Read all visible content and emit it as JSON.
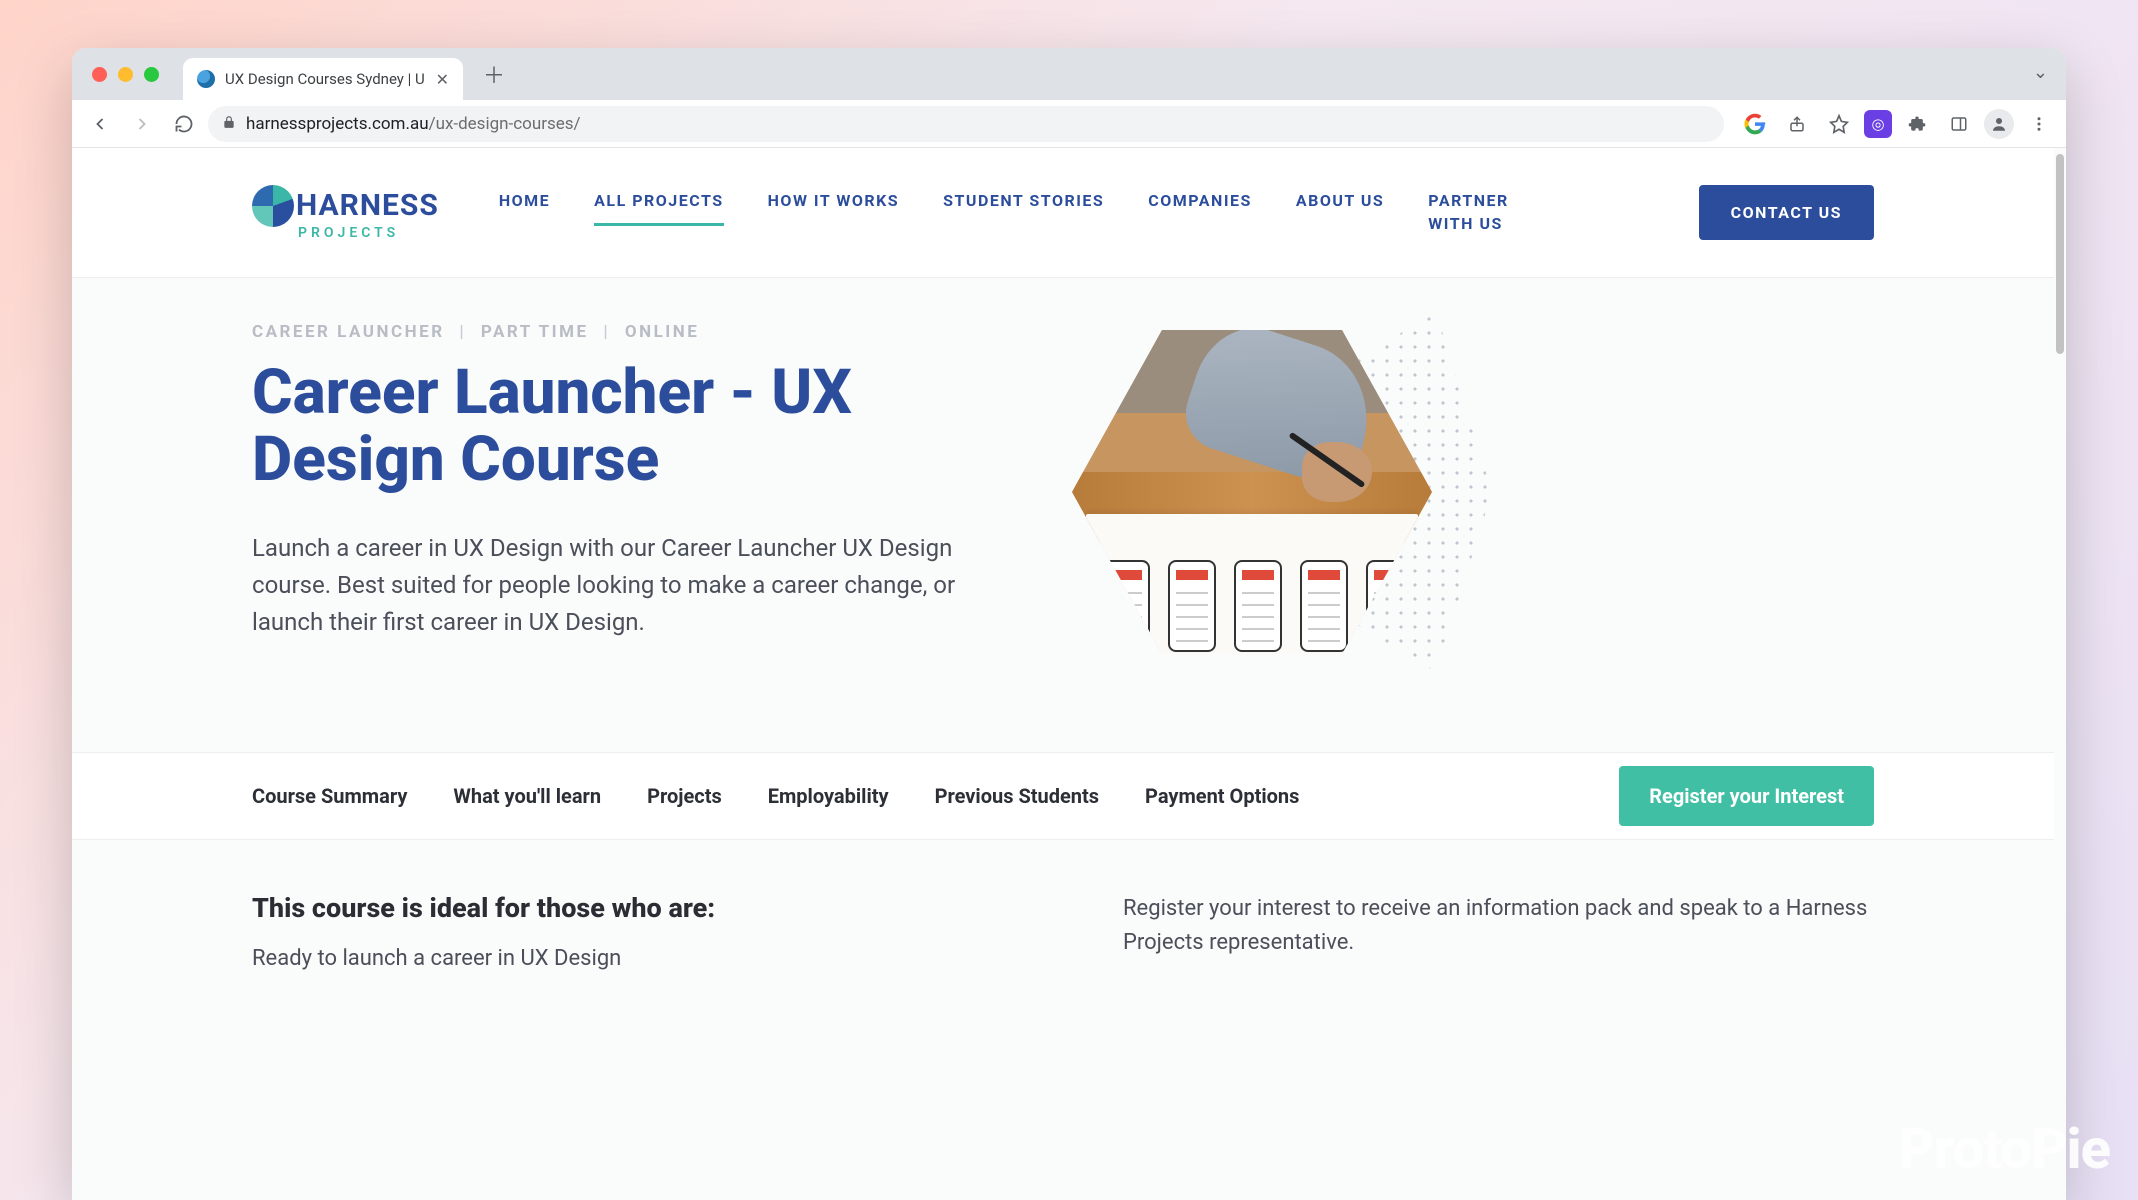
{
  "browser": {
    "tab_title": "UX Design Courses Sydney | U",
    "url_domain": "harnessprojects.com.au",
    "url_path": "/ux-design-courses/"
  },
  "logo": {
    "main": "HARNESS",
    "sub": "PROJECTS"
  },
  "nav": {
    "items": [
      "HOME",
      "ALL PROJECTS",
      "HOW IT WORKS",
      "STUDENT STORIES",
      "COMPANIES",
      "ABOUT US",
      "PARTNER WITH US"
    ],
    "contact": "CONTACT US"
  },
  "hero": {
    "crumbs": [
      "CAREER LAUNCHER",
      "PART TIME",
      "ONLINE"
    ],
    "title": "Career Launcher - UX Design Course",
    "desc": "Launch a career in UX Design with our Career Launcher UX Design course. Best suited for people looking to make a career change, or launch their first career in UX Design."
  },
  "subnav": {
    "items": [
      "Course Summary",
      "What you'll learn",
      "Projects",
      "Employability",
      "Previous Students",
      "Payment Options"
    ],
    "register": "Register your Interest"
  },
  "details": {
    "ideal_heading": "This course is ideal for those who are:",
    "ideal_line": "Ready to launch a career in UX Design",
    "register_blurb": "Register your interest to receive an information pack and speak to a Harness Projects representative."
  },
  "watermark": "ProtoPie"
}
